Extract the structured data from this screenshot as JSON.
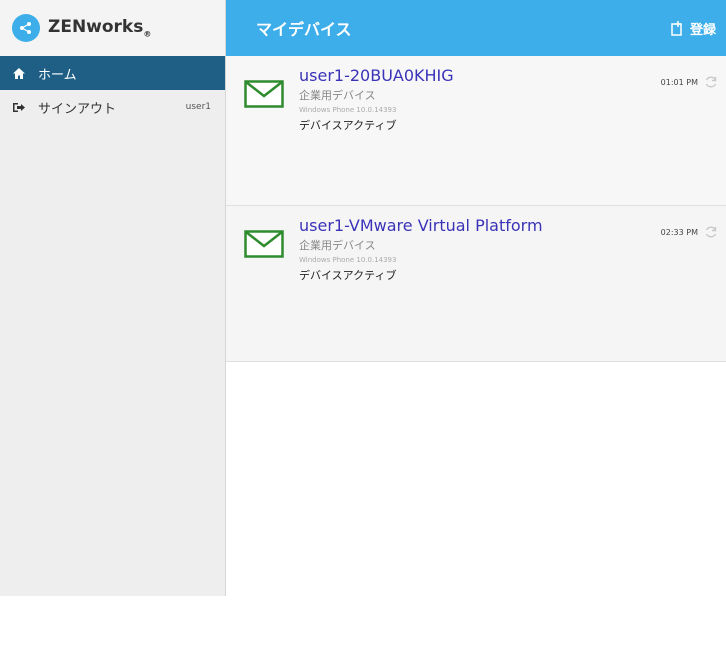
{
  "sidebar": {
    "brand": {
      "name": "ZENworks",
      "reg_mark": "®"
    },
    "items": [
      {
        "label": "ホーム",
        "icon": "home-icon",
        "active": true
      },
      {
        "label": "サインアウト",
        "icon": "sign-out-icon",
        "user": "user1",
        "active": false
      }
    ]
  },
  "header": {
    "title": "マイデバイス",
    "register_label": "登録",
    "accent_color": "#3daee9"
  },
  "devices": [
    {
      "name": "user1-20BUA0KHIG",
      "type": "企業用デバイス",
      "os": "Windows Phone 10.0.14393",
      "status": "デバイスアクティブ",
      "time": "01:01 PM"
    },
    {
      "name": "user1-VMware Virtual Platform",
      "type": "企業用デバイス",
      "os": "Windows Phone 10.0.14393",
      "status": "デバイスアクティブ",
      "time": "02:33 PM"
    }
  ]
}
